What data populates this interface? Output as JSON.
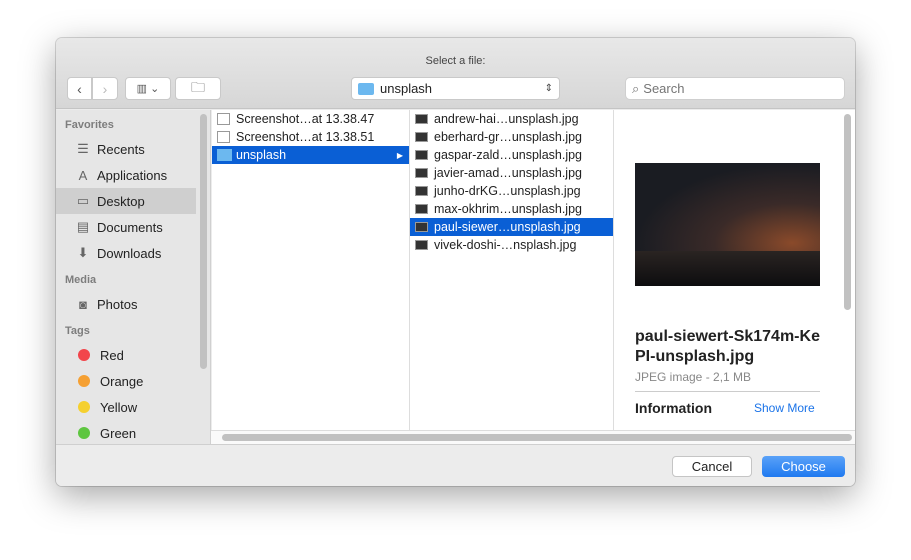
{
  "dialog": {
    "title": "Select a file:"
  },
  "toolbar": {
    "back_icon": "chevron-left",
    "forward_icon": "chevron-right",
    "view_icon": "columns-view",
    "new_folder_icon": "new-folder",
    "location": "unsplash",
    "search_placeholder": "Search"
  },
  "sidebar": {
    "favorites_header": "Favorites",
    "favorites": [
      {
        "label": "Recents",
        "icon": "☰"
      },
      {
        "label": "Applications",
        "icon": "A"
      },
      {
        "label": "Desktop",
        "icon": "▭",
        "selected": true
      },
      {
        "label": "Documents",
        "icon": "▤"
      },
      {
        "label": "Downloads",
        "icon": "⬇"
      }
    ],
    "media_header": "Media",
    "media": [
      {
        "label": "Photos",
        "icon": "◙"
      }
    ],
    "tags_header": "Tags",
    "tags": [
      {
        "label": "Red",
        "color": "#f2454b"
      },
      {
        "label": "Orange",
        "color": "#f5a033"
      },
      {
        "label": "Yellow",
        "color": "#f5d02f"
      },
      {
        "label": "Green",
        "color": "#5ec640"
      }
    ]
  },
  "column1": [
    {
      "label": "Screenshot…at 13.38.47"
    },
    {
      "label": "Screenshot…at 13.38.51"
    },
    {
      "label": "unsplash",
      "selected": true
    }
  ],
  "column2": [
    {
      "label": "andrew-hai…unsplash.jpg"
    },
    {
      "label": "eberhard-gr…unsplash.jpg"
    },
    {
      "label": "gaspar-zald…unsplash.jpg"
    },
    {
      "label": "javier-amad…unsplash.jpg"
    },
    {
      "label": "junho-drKG…unsplash.jpg"
    },
    {
      "label": "max-okhrim…unsplash.jpg"
    },
    {
      "label": "paul-siewer…unsplash.jpg",
      "selected": true
    },
    {
      "label": "vivek-doshi-…nsplash.jpg"
    }
  ],
  "preview": {
    "filename": "paul-siewert-Sk174m-KePI-unsplash.jpg",
    "kind": "JPEG image - 2,1 MB",
    "info_header": "Information",
    "show_more": "Show More"
  },
  "footer": {
    "cancel": "Cancel",
    "choose": "Choose"
  },
  "colors": {
    "accent": "#0a5fd5",
    "choose_button": "#2f86f6"
  }
}
